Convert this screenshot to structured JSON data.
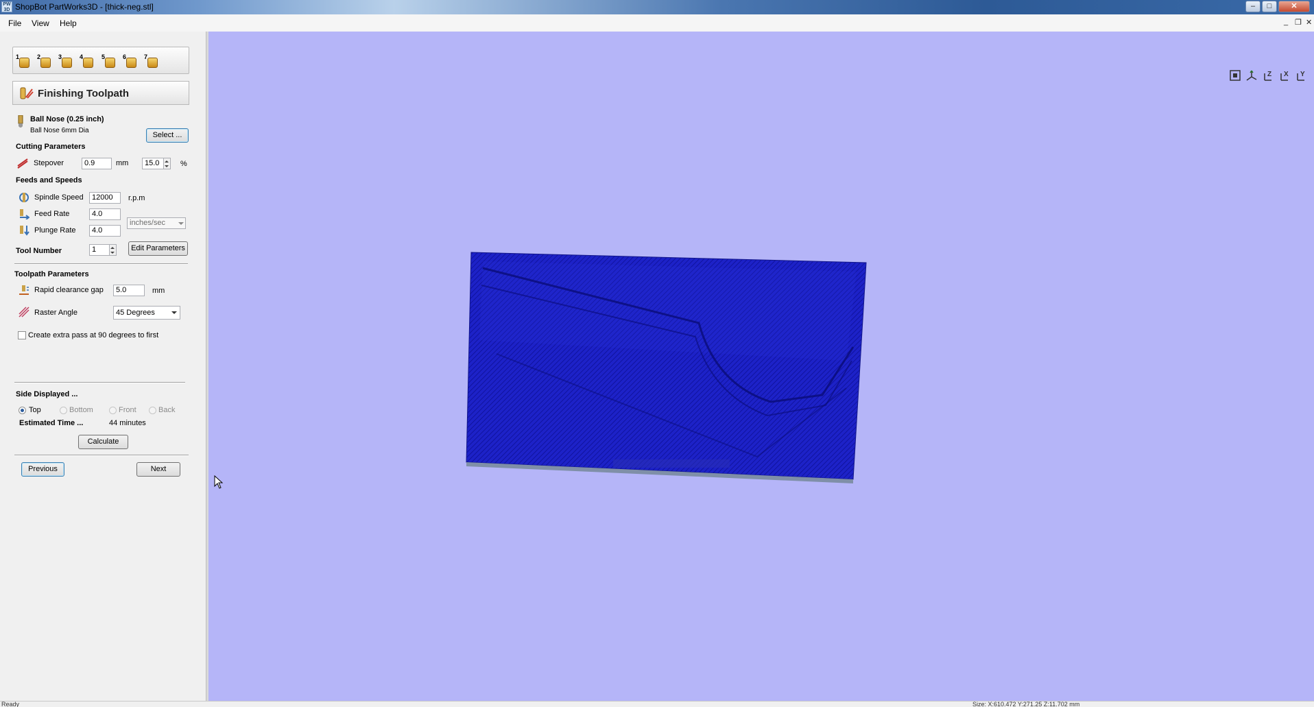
{
  "window": {
    "title": "ShopBot PartWorks3D - [thick-neg.stl]",
    "app_icon_text": "PW 3D"
  },
  "menu": {
    "items": [
      "File",
      "View",
      "Help"
    ]
  },
  "toolbar": {
    "steps": [
      "1",
      "2",
      "3",
      "4",
      "5",
      "6",
      "7"
    ]
  },
  "panel": {
    "title": "Finishing Toolpath",
    "tool": {
      "name": "Ball Nose (0.25 inch)",
      "desc": "Ball Nose 6mm Dia",
      "select_label": "Select ..."
    },
    "cutting": {
      "heading": "Cutting Parameters",
      "stepover_label": "Stepover",
      "stepover_value": "0.9",
      "stepover_unit": "mm",
      "stepover_pct": "15.0",
      "pct_sign": "%"
    },
    "feeds": {
      "heading": "Feeds and Speeds",
      "spindle_label": "Spindle Speed",
      "spindle_value": "12000",
      "spindle_unit": "r.p.m",
      "feed_label": "Feed Rate",
      "feed_value": "4.0",
      "plunge_label": "Plunge Rate",
      "plunge_value": "4.0",
      "rate_unit": "inches/sec"
    },
    "tool_number": {
      "label": "Tool Number",
      "value": "1",
      "edit_label": "Edit Parameters"
    },
    "toolpath": {
      "heading": "Toolpath Parameters",
      "rapid_label": "Rapid clearance gap",
      "rapid_value": "5.0",
      "rapid_unit": "mm",
      "raster_label": "Raster Angle",
      "raster_value": "45 Degrees",
      "extra_pass_label": "Create extra pass at 90 degrees to first",
      "extra_pass_checked": false
    },
    "side": {
      "heading": "Side Displayed ...",
      "options": [
        "Top",
        "Bottom",
        "Front",
        "Back"
      ],
      "selected": "Top"
    },
    "estimate": {
      "label": "Estimated Time ...",
      "value": "44 minutes",
      "calculate_label": "Calculate"
    },
    "nav": {
      "previous_label": "Previous",
      "next_label": "Next"
    }
  },
  "viewport": {
    "background": "#b5b5f8",
    "part_color": "#1b1fc4"
  },
  "status": {
    "left": "Ready",
    "right": "Size: X:610.472 Y:271.25 Z:11.702 mm"
  }
}
